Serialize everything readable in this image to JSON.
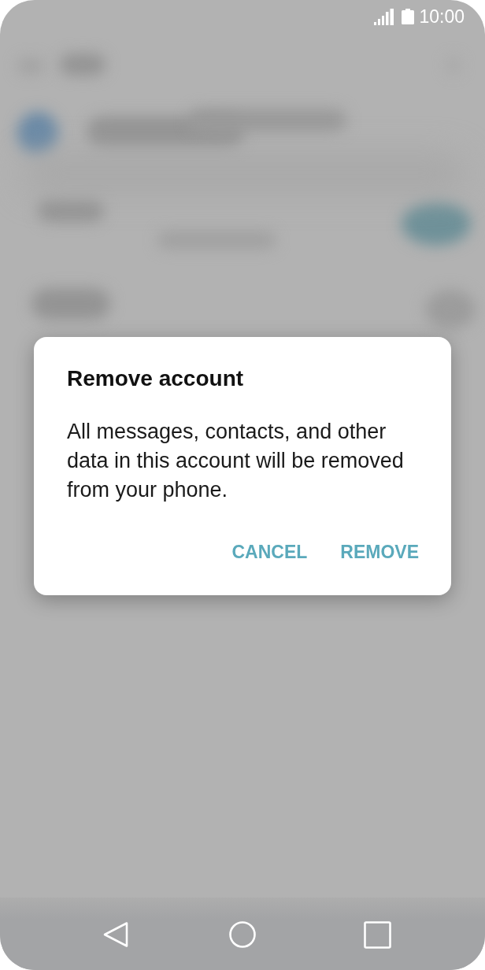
{
  "status_bar": {
    "time": "10:00"
  },
  "dialog": {
    "title": "Remove account",
    "message": "All messages, contacts, and other data in this account will be removed from your phone.",
    "buttons": [
      "CANCEL",
      "REMOVE"
    ]
  }
}
